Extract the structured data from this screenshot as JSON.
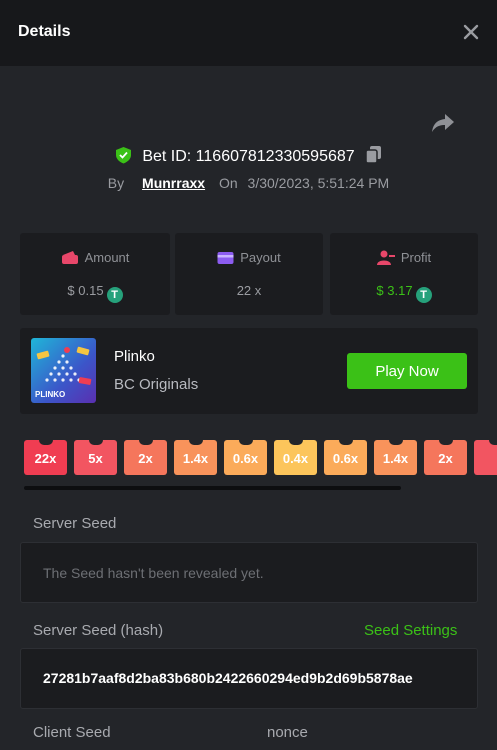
{
  "header": {
    "title": "Details"
  },
  "bet": {
    "id_text": "Bet ID: 116607812330595687",
    "by_label": "By",
    "user": "Munrraxx",
    "on_label": "On",
    "datetime": "3/30/2023, 5:51:24 PM"
  },
  "stats": [
    {
      "label": "Amount",
      "value": "$ 0.15",
      "icon": "wallet-icon"
    },
    {
      "label": "Payout",
      "value": "22 x",
      "icon": "card-icon"
    },
    {
      "label": "Profit",
      "value": "$ 3.17",
      "icon": "profit-icon"
    }
  ],
  "coin_symbol": "T",
  "game": {
    "name": "Plinko",
    "provider": "BC Originals",
    "thumb_text": "PLINKO",
    "play_label": "Play Now"
  },
  "multipliers": [
    {
      "label": "22x",
      "color": "#f03d52"
    },
    {
      "label": "5x",
      "color": "#f25561"
    },
    {
      "label": "2x",
      "color": "#f5765c"
    },
    {
      "label": "1.4x",
      "color": "#f8935b"
    },
    {
      "label": "0.6x",
      "color": "#fbab5a"
    },
    {
      "label": "0.4x",
      "color": "#fcc55b"
    },
    {
      "label": "0.6x",
      "color": "#fbab5a"
    },
    {
      "label": "1.4x",
      "color": "#f8935b"
    },
    {
      "label": "2x",
      "color": "#f5765c"
    },
    {
      "label": "",
      "color": "#f25561"
    }
  ],
  "seeds": {
    "server_label": "Server Seed",
    "server_value": "The Seed hasn't been revealed yet.",
    "hash_label": "Server Seed (hash)",
    "settings_link": "Seed Settings",
    "hash_value": "27281b7aaf8d2ba83b680b2422660294ed9b2d69b5878ae",
    "client_label": "Client Seed",
    "nonce_label": "nonce"
  },
  "colors": {
    "accent_green": "#3bc117",
    "background": "#232529",
    "panel": "#1b1c1f"
  }
}
